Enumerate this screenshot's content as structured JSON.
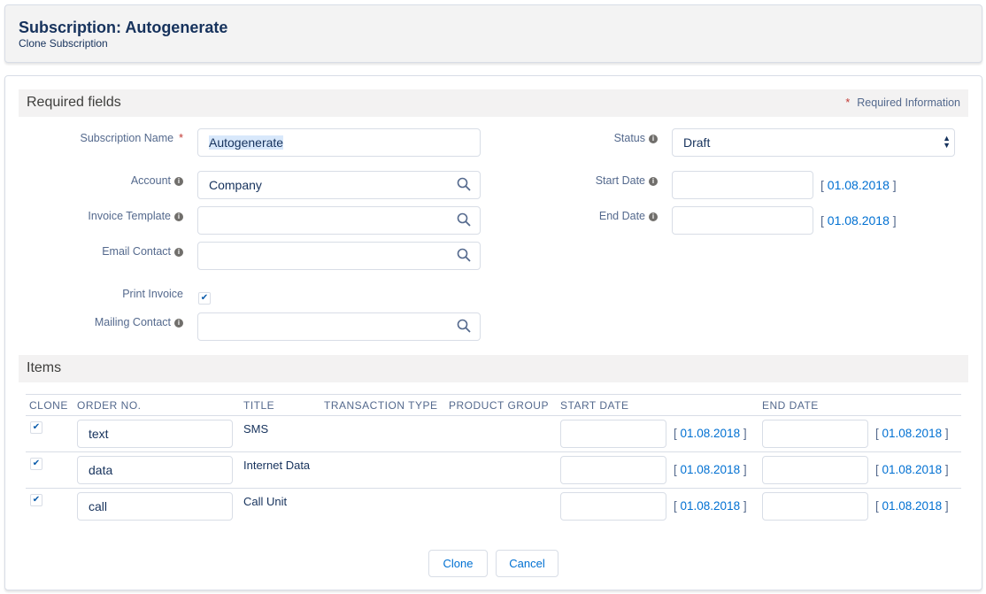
{
  "header": {
    "title": "Subscription: Autogenerate",
    "subtitle": "Clone Subscription"
  },
  "required_section": {
    "title": "Required fields",
    "required_info": "Required Information",
    "required_mark": "*"
  },
  "fields": {
    "subscription_name": {
      "label": "Subscription Name",
      "value": "Autogenerate"
    },
    "account": {
      "label": "Account",
      "value": "Company"
    },
    "invoice_template": {
      "label": "Invoice Template",
      "value": ""
    },
    "email_contact": {
      "label": "Email Contact",
      "value": ""
    },
    "print_invoice": {
      "label": "Print Invoice",
      "checked": true
    },
    "mailing_contact": {
      "label": "Mailing Contact",
      "value": ""
    },
    "status": {
      "label": "Status",
      "value": "Draft"
    },
    "start_date": {
      "label": "Start Date",
      "value": "",
      "default_link": "01.08.2018"
    },
    "end_date": {
      "label": "End Date",
      "value": "",
      "default_link": "01.08.2018"
    }
  },
  "items": {
    "title": "Items",
    "columns": [
      "CLONE",
      "ORDER NO.",
      "TITLE",
      "TRANSACTION TYPE",
      "PRODUCT GROUP",
      "START DATE",
      "END DATE"
    ],
    "rows": [
      {
        "clone": true,
        "order_no": "text",
        "title": "SMS",
        "start_link": "01.08.2018",
        "end_link": "01.08.2018"
      },
      {
        "clone": true,
        "order_no": "data",
        "title": "Internet Data",
        "start_link": "01.08.2018",
        "end_link": "01.08.2018"
      },
      {
        "clone": true,
        "order_no": "call",
        "title": "Call Unit",
        "start_link": "01.08.2018",
        "end_link": "01.08.2018"
      }
    ]
  },
  "actions": {
    "clone": "Clone",
    "cancel": "Cancel"
  }
}
